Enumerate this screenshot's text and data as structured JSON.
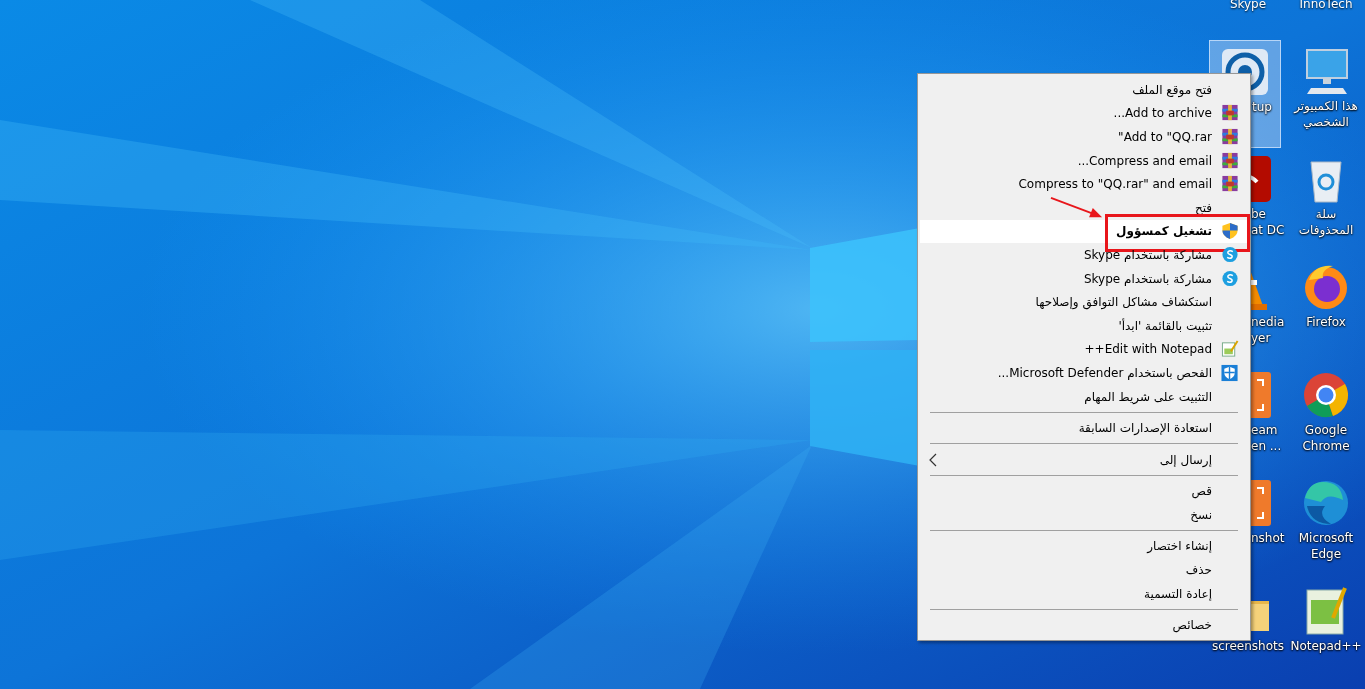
{
  "desktop": {
    "top_labels": [
      "InnoTech",
      "Skype"
    ],
    "columns": [
      {
        "icons": [
          {
            "kind": "computer",
            "lines": [
              "هذا الكمبيوتر",
              "الشخصي"
            ],
            "covered": false,
            "selected": false
          },
          {
            "kind": "recycle",
            "lines": [
              "سلة",
              "المحذوفات"
            ],
            "covered": false,
            "selected": false
          },
          {
            "kind": "firefox",
            "lines": [
              "Firefox"
            ],
            "covered": false,
            "selected": false
          },
          {
            "kind": "chrome",
            "lines": [
              "Google",
              "Chrome"
            ],
            "covered": false,
            "selected": false
          },
          {
            "kind": "edge",
            "lines": [
              "Microsoft",
              "Edge"
            ],
            "covered": false,
            "selected": false
          },
          {
            "kind": "notepad",
            "lines": [
              "Notepad++"
            ],
            "covered": false,
            "selected": false
          }
        ]
      },
      {
        "icons": [
          {
            "kind": "skype-setup",
            "lines": [
              "tup"
            ],
            "covered": true,
            "selected": true
          },
          {
            "kind": "adobe",
            "lines": [
              "be",
              "at DC"
            ],
            "covered": true,
            "selected": false
          },
          {
            "kind": "vlc",
            "lines": [
              "nedia",
              "yer"
            ],
            "covered": true,
            "selected": false
          },
          {
            "kind": "orange",
            "lines": [
              "eam",
              "en ..."
            ],
            "covered": true,
            "selected": false
          },
          {
            "kind": "orange",
            "lines": [
              "nshot"
            ],
            "covered": true,
            "selected": false
          },
          {
            "kind": "folder",
            "lines": [
              "screenshots"
            ],
            "covered": false,
            "selected": false
          }
        ]
      }
    ]
  },
  "context_menu": {
    "items": [
      {
        "kind": "item",
        "text": "فتح موقع الملف",
        "selected": false
      },
      {
        "kind": "item",
        "text": "Add to archive...",
        "selected": false
      },
      {
        "kind": "item",
        "text": "Add to \"QQ.rar\"",
        "selected": false
      },
      {
        "kind": "item",
        "text": "Compress and email...",
        "selected": false
      },
      {
        "kind": "item",
        "text": "Compress to \"QQ.rar\" and email",
        "selected": false
      },
      {
        "kind": "item",
        "text": "فتح",
        "selected": false
      },
      {
        "kind": "item",
        "text": "تشغيل كمسؤول",
        "selected": true,
        "marked": true
      },
      {
        "kind": "item",
        "text": "مشاركة باستخدام Skype",
        "selected": false
      },
      {
        "kind": "item",
        "text": "مشاركة باستخدام Skype",
        "selected": false
      },
      {
        "kind": "item",
        "text": "استكشاف مشاكل التوافق وإصلاحها",
        "selected": false
      },
      {
        "kind": "item",
        "text": "تثبيت بالقائمة 'ابدأ'",
        "selected": false
      },
      {
        "kind": "item",
        "text": "Edit with Notepad++",
        "selected": false
      },
      {
        "kind": "item",
        "text": "الفحص باستخدام Microsoft Defender...",
        "selected": false
      },
      {
        "kind": "item",
        "text": "التثبيت على شريط المهام",
        "selected": false
      },
      {
        "kind": "separator"
      },
      {
        "kind": "item",
        "text": "استعادة الإصدارات السابقة",
        "selected": false
      },
      {
        "kind": "separator"
      },
      {
        "kind": "submenu",
        "text": "إرسال إلى",
        "selected": false
      },
      {
        "kind": "separator"
      },
      {
        "kind": "item",
        "text": "قص",
        "selected": false
      },
      {
        "kind": "item",
        "text": "نسخ",
        "selected": false
      },
      {
        "kind": "separator"
      },
      {
        "kind": "item",
        "text": "إنشاء اختصار",
        "selected": false
      },
      {
        "kind": "item",
        "text": "حذف",
        "selected": false
      },
      {
        "kind": "item",
        "text": "إعادة التسمية",
        "selected": false
      },
      {
        "kind": "separator"
      },
      {
        "kind": "item",
        "text": "خصائص",
        "selected": false
      }
    ]
  }
}
